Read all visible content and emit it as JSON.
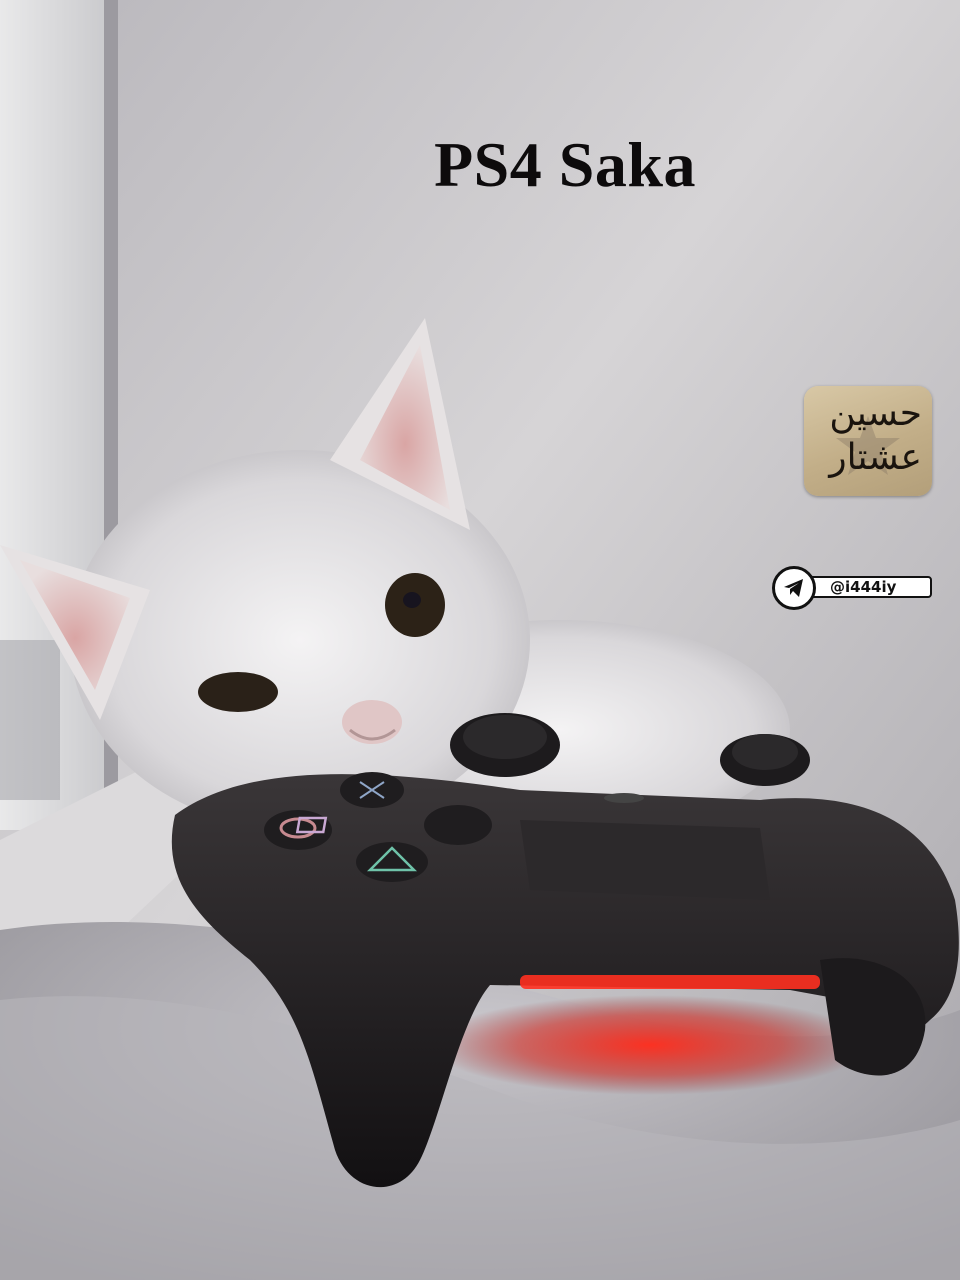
{
  "title": "PS4 Saka",
  "logo": {
    "line1": "حسين",
    "line2": "عشتار"
  },
  "handle": {
    "text": "@i444iy",
    "icon": "telegram-icon"
  },
  "photo": {
    "subject": "cat-with-controller",
    "controller_light_color": "#ff2a1a"
  }
}
